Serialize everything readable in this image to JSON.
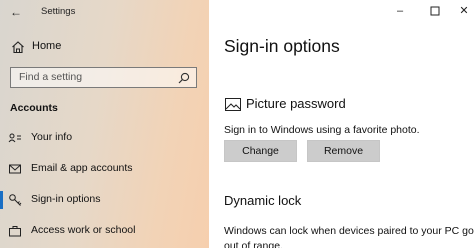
{
  "window": {
    "title": "Settings"
  },
  "sidebar": {
    "home_label": "Home",
    "search_placeholder": "Find a setting",
    "section_header": "Accounts",
    "items": [
      {
        "label": "Your info",
        "icon": "person-info-icon"
      },
      {
        "label": "Email & app accounts",
        "icon": "mail-icon"
      },
      {
        "label": "Sign-in options",
        "icon": "key-icon",
        "selected": true
      },
      {
        "label": "Access work or school",
        "icon": "briefcase-icon"
      }
    ]
  },
  "content": {
    "title": "Sign-in options",
    "picture_password": {
      "heading": "Picture password",
      "description": "Sign in to Windows using a favorite photo.",
      "change_label": "Change",
      "remove_label": "Remove"
    },
    "dynamic_lock": {
      "heading": "Dynamic lock",
      "description_line1": "Windows can lock when devices paired to your PC go",
      "description_line2": "out of range."
    }
  },
  "colors": {
    "accent": "#1a6fc4",
    "button_bg": "#cccccc"
  }
}
